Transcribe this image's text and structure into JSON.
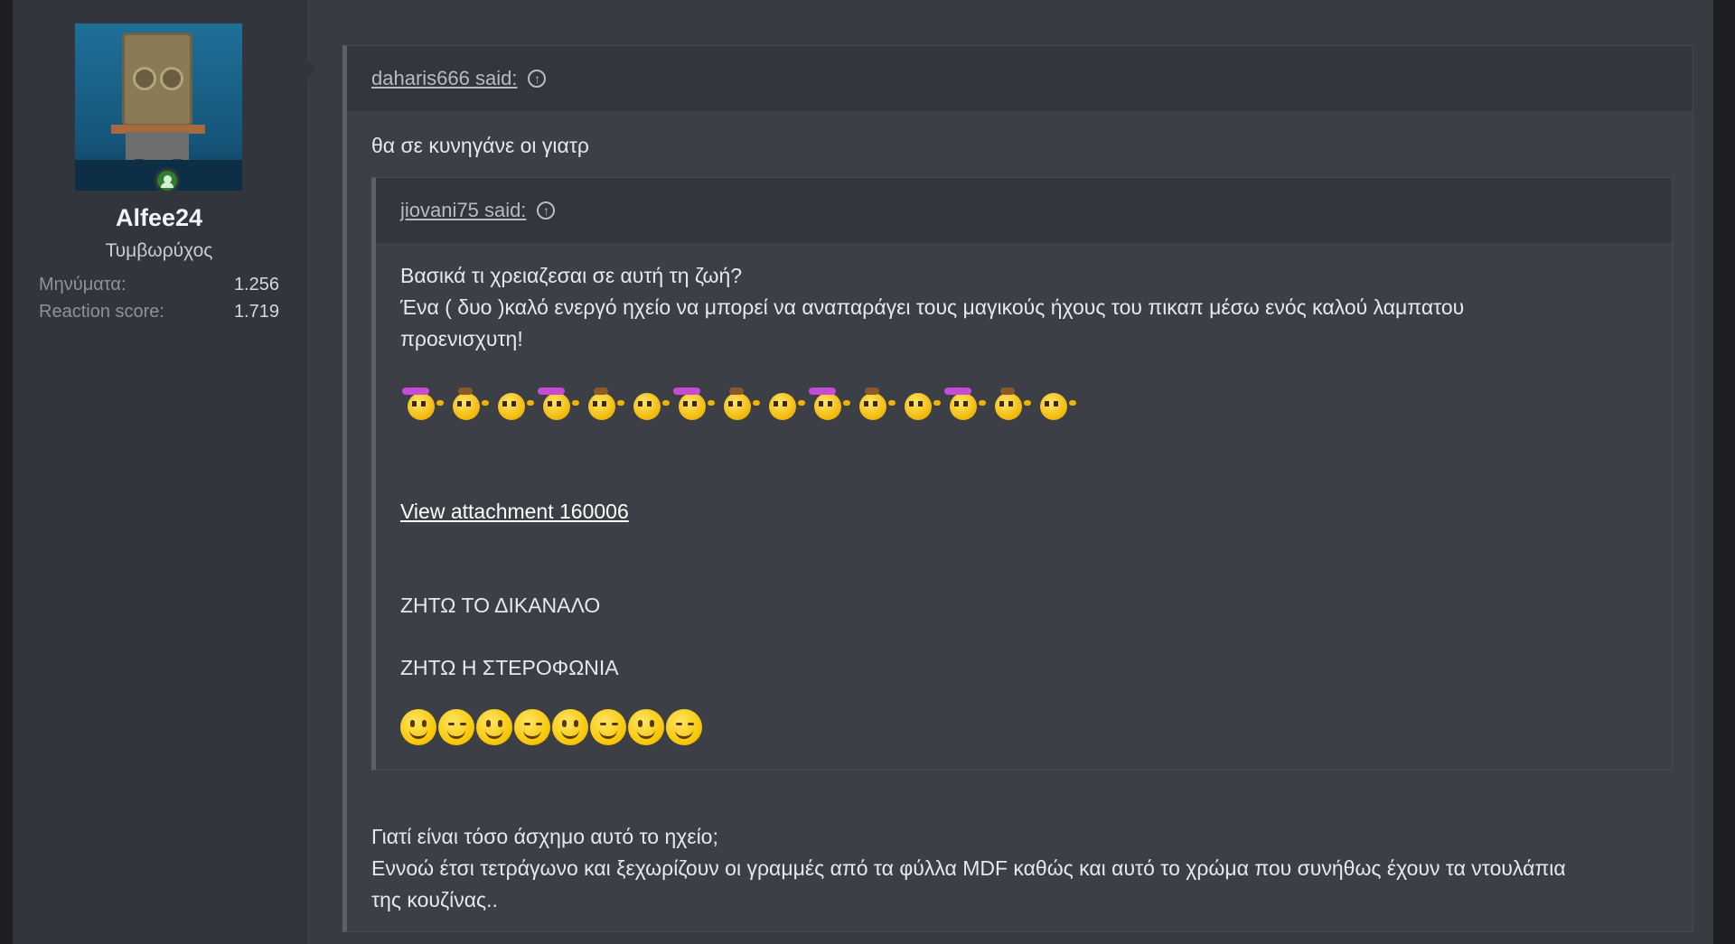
{
  "user": {
    "name": "Alfee24",
    "title": "Τυμβωρύχος",
    "stats": [
      {
        "label": "Μηνύματα:",
        "value": "1.256"
      },
      {
        "label": "Reaction score:",
        "value": "1.719"
      }
    ]
  },
  "outer_quote": {
    "author_label": "daharis666 said:",
    "body": "θα σε κυνηγάνε οι γιατρ"
  },
  "inner_quote": {
    "author_label": "jiovani75 said:",
    "line1": "Βασικά τι χρειαζεσαι σε αυτή τη ζωή?",
    "line2": "Ένα ( δυο )καλό ενεργό ηχείο να μπορεί να αναπαράγει τους μαγικούς ήχους του πικαπ μέσω ενός καλού λαμπατου",
    "line3": "προενισχυτη!",
    "attachment_link": "View attachment 160006",
    "shout1": "ΖΗΤΩ ΤΟ ΔΙΚΑΝΑΛΟ",
    "shout2": "ΖΗΤΩ Η ΣΤΕΡΟΦΩΝΙΑ"
  },
  "reply": {
    "line1": "Γιατί είναι τόσο άσχημο αυτό το ηχείο;",
    "line2": "Εννοώ έτσι τετράγωνο και ξεχωρίζουν οι γραμμές από τα φύλλα MDF καθώς και αυτό το χρώμα που συνήθως έχουν τα ντουλάπια",
    "line3": "της κουζίνας.."
  },
  "icons": {
    "up_arrow": "arrow-up-circle-icon",
    "online": "online-user-icon"
  },
  "colors": {
    "page_bg": "#383b42",
    "user_col_bg": "#32353b",
    "quote_bg": "#3c3f46",
    "quote_head_bg": "#33363c",
    "online_green": "#2f7d2f"
  }
}
